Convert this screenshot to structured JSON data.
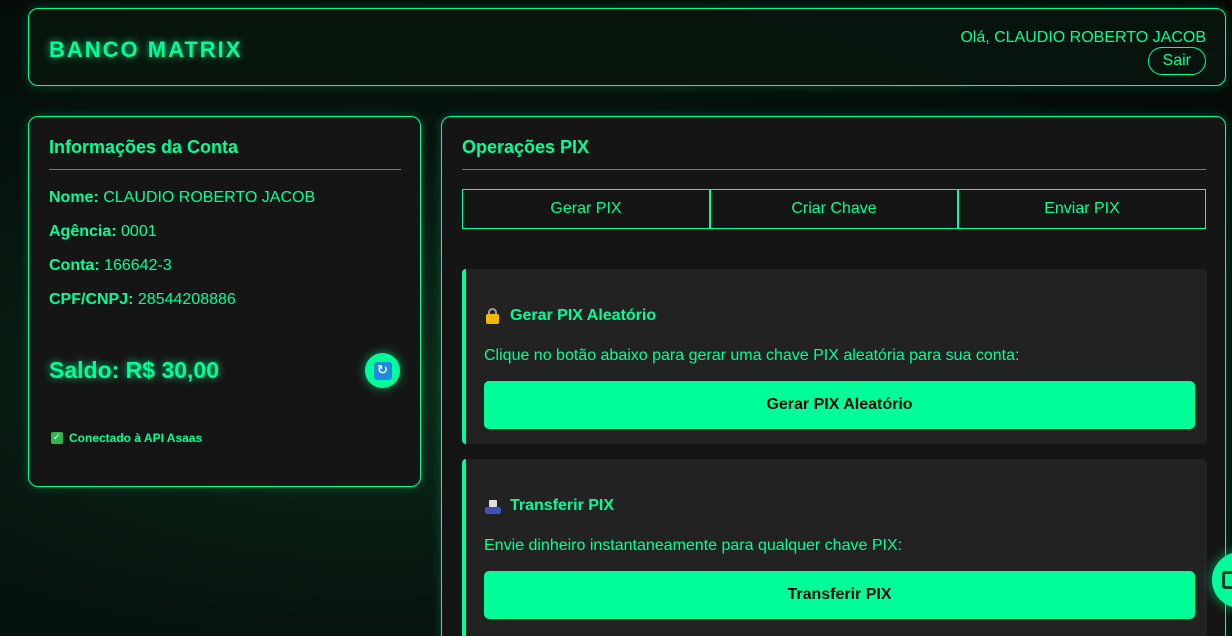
{
  "header": {
    "brand": "BANCO MATRIX",
    "greeting": "Olá, CLAUDIO ROBERTO JACOB",
    "logout_label": "Sair"
  },
  "account": {
    "title": "Informações da Conta",
    "fields": [
      {
        "label": "Nome:",
        "value": "CLAUDIO ROBERTO JACOB"
      },
      {
        "label": "Agência:",
        "value": "0001"
      },
      {
        "label": "Conta:",
        "value": "166642-3"
      },
      {
        "label": "CPF/CNPJ:",
        "value": "28544208886"
      }
    ],
    "balance_label": "Saldo:",
    "balance_value": "R$ 30,00",
    "refresh_icon": "refresh-icon",
    "api_status": "Conectado à API Asaas",
    "api_status_icon": "check-icon"
  },
  "pix": {
    "title": "Operações PIX",
    "tabs": [
      {
        "label": "Gerar PIX"
      },
      {
        "label": "Criar Chave"
      },
      {
        "label": "Enviar PIX"
      }
    ],
    "cards": [
      {
        "icon": "lock-icon",
        "title": "Gerar PIX Aleatório",
        "description": "Clique no botão abaixo para gerar uma chave PIX aleatória para sua conta:",
        "button_label": "Gerar PIX Aleatório"
      },
      {
        "icon": "transfer-icon",
        "title": "Transferir PIX",
        "description": "Envie dinheiro instantaneamente para qualquer chave PIX:",
        "button_label": "Transferir PIX"
      }
    ]
  },
  "chat_icon": "chat-icon",
  "colors": {
    "accent": "#00ff99",
    "panel": "#151515",
    "card": "#222222",
    "background": "#06140d"
  }
}
